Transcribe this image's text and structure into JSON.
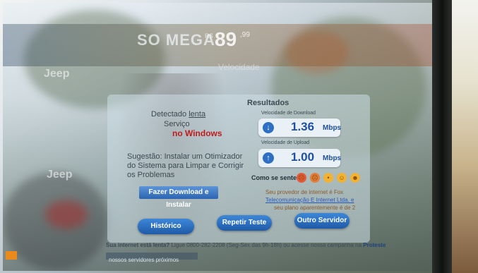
{
  "banner": {
    "brand": "SO MEGA",
    "currency": "R$",
    "price": "89",
    "cents": ",99",
    "subtitle": "Velocidade"
  },
  "left_ghost": {
    "text_a": "Jeep",
    "text_b": "Jeep"
  },
  "problem": {
    "line1": "Detectado",
    "lenta": "lenta",
    "line2": "Serviço",
    "red_text": "no Windows",
    "suggestion": "Sugestão: Instalar um Otimizador",
    "suggestion2": "do Sistema para Limpar e Corrigir",
    "suggestion3": "os Problemas",
    "download_btn": "Fazer Download e Instalar"
  },
  "results": {
    "heading": "Resultados",
    "download_label": "Velocidade de Download",
    "download_value": "1.36",
    "download_unit": "Mbps",
    "upload_label": "Velocidade de Upload",
    "upload_value": "1.00",
    "upload_unit": "Mbps",
    "feel_label": "Como se sente?",
    "provider_line1": "Seu provedor de internet é Fox",
    "provider_line2": "Telecomunicação E Internet Ltda. e",
    "provider_line3": "seu plano aparentemente é de 2"
  },
  "buttons": {
    "history": "Histórico",
    "retest": "Repetir Teste",
    "other_server": "Outro Servidor"
  },
  "footer": {
    "question": "Sua internet está lenta?",
    "contact": "Ligue 0800-282-2208",
    "hours": "(Seg-Sex das 9h-18h) ou acesse nossa campanha na",
    "link": "Proteste",
    "bottom_tab": "nossos servidores próximos"
  },
  "colors": {
    "accent_blue": "#2e6fc4",
    "alert_red": "#c21a1a"
  }
}
